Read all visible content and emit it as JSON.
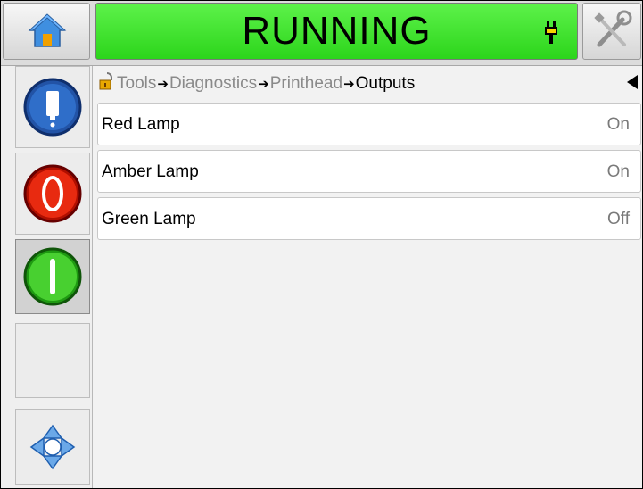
{
  "status": {
    "text": "RUNNING",
    "color": "#2fd61c"
  },
  "top": {
    "home_icon": "home-icon",
    "tools_icon": "tools-icon",
    "status_icon": "ink-plug-icon"
  },
  "sidebar": {
    "items": [
      {
        "name": "ink-status",
        "icon": "ink-bottle-icon"
      },
      {
        "name": "stop",
        "icon": "stop-icon",
        "color": "#e01b00"
      },
      {
        "name": "start",
        "icon": "start-icon",
        "color": "#2fbf1f"
      },
      {
        "name": "empty",
        "icon": ""
      },
      {
        "name": "navigate",
        "icon": "navigation-arrows-icon"
      }
    ]
  },
  "breadcrumb": {
    "items": [
      "Tools",
      "Diagnostics",
      "Printhead",
      "Outputs"
    ],
    "separator": "➔"
  },
  "outputs": [
    {
      "label": "Red Lamp",
      "value": "On"
    },
    {
      "label": "Amber Lamp",
      "value": "On"
    },
    {
      "label": "Green Lamp",
      "value": "Off"
    }
  ]
}
